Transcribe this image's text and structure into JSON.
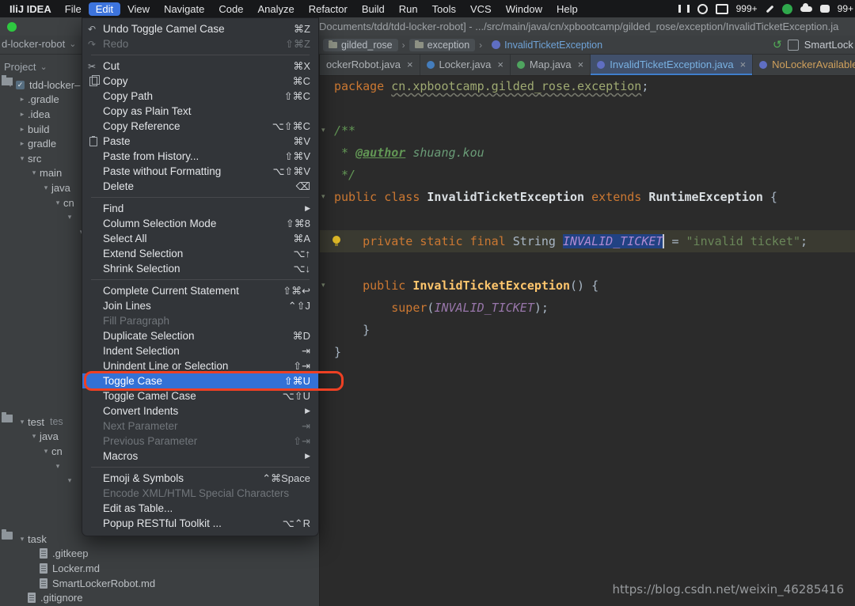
{
  "menubar": {
    "app_name": "IliJ IDEA",
    "items": [
      "File",
      "Edit",
      "View",
      "Navigate",
      "Code",
      "Analyze",
      "Refactor",
      "Build",
      "Run",
      "Tools",
      "VCS",
      "Window",
      "Help"
    ],
    "active_item": "Edit",
    "status_icons": [
      {
        "type": "pause",
        "name": "pause-icon"
      },
      {
        "type": "record",
        "name": "record-icon"
      },
      {
        "type": "camera",
        "name": "camera-icon"
      },
      {
        "type": "badge",
        "text": "999+",
        "name": "notifications-badge"
      },
      {
        "type": "wrench",
        "name": "wrench-icon"
      },
      {
        "type": "n-circle",
        "name": "app-n-icon"
      },
      {
        "type": "cloud",
        "name": "cloud-icon"
      },
      {
        "type": "bubble",
        "name": "chat-icon"
      },
      {
        "type": "badge",
        "text": "99+",
        "name": "messages-badge"
      }
    ]
  },
  "titlebar": {
    "title": "Documents/tdd/tdd-locker-robot] - .../src/main/java/cn/xpbootcamp/gilded_rose/exception/InvalidTicketException.ja"
  },
  "nav": {
    "collapsed_project": "d-locker-robot",
    "breadcrumbs": [
      {
        "label": "gilded_rose",
        "icon": "folder"
      },
      {
        "label": "exception",
        "icon": "folder"
      },
      {
        "label": "InvalidTicketException",
        "icon": "class"
      }
    ],
    "run_widget_label": "SmartLock"
  },
  "project_panel": {
    "header": "Project",
    "tree_top": [
      {
        "arrow": "down",
        "icon": "project",
        "label": "tdd-locker–",
        "indent": 0
      },
      {
        "arrow": "right",
        "icon": "folder-orange",
        "label": ".gradle",
        "indent": 1
      },
      {
        "arrow": "right",
        "icon": "folder",
        "label": ".idea",
        "indent": 1
      },
      {
        "arrow": "right",
        "icon": "folder-orange",
        "label": "build",
        "indent": 1
      },
      {
        "arrow": "right",
        "icon": "folder",
        "label": "gradle",
        "indent": 1
      },
      {
        "arrow": "down",
        "icon": "folder",
        "label": "src",
        "indent": 1
      },
      {
        "arrow": "down",
        "icon": "folder",
        "label": "main",
        "indent": 2
      },
      {
        "arrow": "down",
        "icon": "folder-blue",
        "label": "java",
        "indent": 3
      },
      {
        "arrow": "down",
        "icon": "folder",
        "label": "cn",
        "indent": 4
      },
      {
        "arrow": "down",
        "icon": "none",
        "label": "",
        "indent": 5
      },
      {
        "arrow": "down",
        "icon": "none",
        "label": "",
        "indent": 6
      }
    ],
    "tree_middle": [
      {
        "arrow": "down",
        "icon": "folder-green",
        "label": "test",
        "extra": "tes",
        "indent": 1
      },
      {
        "arrow": "down",
        "icon": "folder-green",
        "label": "java",
        "indent": 2
      },
      {
        "arrow": "down",
        "icon": "folder",
        "label": "cn",
        "indent": 3
      },
      {
        "arrow": "down",
        "icon": "none",
        "label": "",
        "indent": 4
      },
      {
        "arrow": "down",
        "icon": "none",
        "label": "",
        "indent": 5
      }
    ],
    "tree_bottom": [
      {
        "arrow": "down",
        "icon": "folder",
        "label": "task",
        "indent": 1
      },
      {
        "arrow": null,
        "icon": "file",
        "label": ".gitkeep",
        "indent": 2
      },
      {
        "arrow": null,
        "icon": "file",
        "label": "Locker.md",
        "indent": 2
      },
      {
        "arrow": null,
        "icon": "file",
        "label": "SmartLockerRobot.md",
        "indent": 2
      },
      {
        "arrow": null,
        "icon": "file",
        "label": ".gitignore",
        "indent": 1
      }
    ]
  },
  "tabs": [
    {
      "label": "ockerRobot.java",
      "icon": null,
      "close": true
    },
    {
      "label": "Locker.java",
      "icon": "blue",
      "close": true
    },
    {
      "label": "Map.java",
      "icon": "green",
      "close": true
    },
    {
      "label": "InvalidTicketException.java",
      "icon": "purple",
      "close": true,
      "active": true
    },
    {
      "label": "NoLockerAvailableException.j",
      "icon": "purple",
      "close": false,
      "warn": true
    }
  ],
  "edit_menu": {
    "sections": [
      {
        "items": [
          {
            "label": "Undo Toggle Camel Case",
            "icon": "undo",
            "shortcut": "⌘Z"
          },
          {
            "label": "Redo",
            "icon": "redo",
            "shortcut": "⇧⌘Z",
            "disabled": true
          }
        ]
      },
      {
        "items": [
          {
            "label": "Cut",
            "icon": "cut",
            "shortcut": "⌘X"
          },
          {
            "label": "Copy",
            "icon": "copy",
            "shortcut": "⌘C"
          },
          {
            "label": "Copy Path",
            "shortcut": "⇧⌘C"
          },
          {
            "label": "Copy as Plain Text"
          },
          {
            "label": "Copy Reference",
            "shortcut": "⌥⇧⌘C"
          },
          {
            "label": "Paste",
            "icon": "paste",
            "shortcut": "⌘V"
          },
          {
            "label": "Paste from History...",
            "shortcut": "⇧⌘V"
          },
          {
            "label": "Paste without Formatting",
            "shortcut": "⌥⇧⌘V"
          },
          {
            "label": "Delete",
            "shortcut": "⌫"
          }
        ]
      },
      {
        "items": [
          {
            "label": "Find",
            "submenu": true
          },
          {
            "label": "Column Selection Mode",
            "shortcut": "⇧⌘8"
          },
          {
            "label": "Select All",
            "shortcut": "⌘A"
          },
          {
            "label": "Extend Selection",
            "shortcut": "⌥↑"
          },
          {
            "label": "Shrink Selection",
            "shortcut": "⌥↓"
          }
        ]
      },
      {
        "items": [
          {
            "label": "Complete Current Statement",
            "shortcut": "⇧⌘↩"
          },
          {
            "label": "Join Lines",
            "shortcut": "⌃⇧J"
          },
          {
            "label": "Fill Paragraph",
            "disabled": true
          },
          {
            "label": "Duplicate Selection",
            "shortcut": "⌘D"
          },
          {
            "label": "Indent Selection",
            "shortcut": "⇥"
          },
          {
            "label": "Unindent Line or Selection",
            "shortcut": "⇧⇥"
          },
          {
            "label": "Toggle Case",
            "shortcut": "⇧⌘U",
            "highlighted": true,
            "annotated": true
          },
          {
            "label": "Toggle Camel Case",
            "shortcut": "⌥⇧U"
          },
          {
            "label": "Convert Indents",
            "submenu": true
          },
          {
            "label": "Next Parameter",
            "shortcut": "⇥",
            "disabled": true
          },
          {
            "label": "Previous Parameter",
            "shortcut": "⇧⇥",
            "disabled": true
          },
          {
            "label": "Macros",
            "submenu": true
          }
        ]
      },
      {
        "items": [
          {
            "label": "Emoji & Symbols",
            "shortcut": "⌃⌘Space"
          },
          {
            "label": "Encode XML/HTML Special Characters",
            "disabled": true
          },
          {
            "label": "Edit as Table..."
          },
          {
            "label": "Popup RESTful Toolkit ...",
            "shortcut": "⌥⌃R"
          }
        ]
      }
    ]
  },
  "editor": {
    "lines": [
      {
        "tokens": [
          [
            "kw",
            "package "
          ],
          [
            "pkg",
            "cn.xpbootcamp.gilded_rose.exception"
          ],
          [
            "pl",
            ";"
          ]
        ]
      },
      {
        "tokens": []
      },
      {
        "fold": true,
        "tokens": [
          [
            "doc",
            "/**"
          ]
        ]
      },
      {
        "tokens": [
          [
            "doc",
            " * "
          ],
          [
            "doctag",
            "@author"
          ],
          [
            "docname",
            " shuang.kou"
          ]
        ]
      },
      {
        "tokens": [
          [
            "doc",
            " */"
          ]
        ]
      },
      {
        "fold": true,
        "tokens": [
          [
            "kw",
            "public class "
          ],
          [
            "cls",
            "InvalidTicketException"
          ],
          [
            "kw",
            " extends "
          ],
          [
            "cls",
            "RuntimeException"
          ],
          [
            "pl",
            " {"
          ]
        ]
      },
      {
        "tokens": []
      },
      {
        "current": true,
        "bulb": true,
        "tokens": [
          [
            "kw",
            "    private static final "
          ],
          [
            "pl",
            "String "
          ],
          [
            "sel",
            "INVALID_TICKET"
          ],
          [
            "pl",
            " = "
          ],
          [
            "str",
            "\"invalid ticket\""
          ],
          [
            "pl",
            ";"
          ]
        ]
      },
      {
        "tokens": []
      },
      {
        "fold": true,
        "tokens": [
          [
            "kw",
            "    public "
          ],
          [
            "method",
            "InvalidTicketException"
          ],
          [
            "pl",
            "() {"
          ]
        ]
      },
      {
        "tokens": [
          [
            "kw",
            "        super"
          ],
          [
            "pl",
            "("
          ],
          [
            "field",
            "INVALID_TICKET"
          ],
          [
            "pl",
            ");"
          ]
        ]
      },
      {
        "tokens": [
          [
            "pl",
            "    }"
          ]
        ]
      },
      {
        "tokens": [
          [
            "pl",
            "}"
          ]
        ]
      }
    ],
    "watermark": "https://blog.csdn.net/weixin_46285416"
  },
  "icons": {
    "tree_expanded": "▾",
    "tree_collapsed": "▸",
    "submenu": "▶",
    "close": "×",
    "undo": "↶",
    "redo": "↷",
    "cut": "✂",
    "rerun": "↺",
    "caret_down": "⌄",
    "fold": "▾",
    "check": "✓"
  }
}
